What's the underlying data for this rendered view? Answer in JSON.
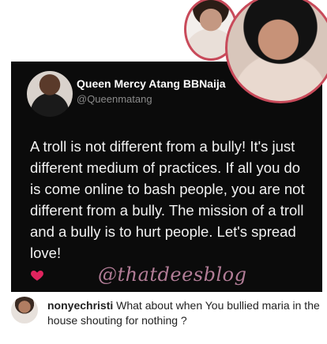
{
  "post": {
    "author_name": "Queen Mercy Atang BBNaija",
    "author_handle": "@Queenmatang",
    "text": "A troll is not different from a bully! It's just different medium of practices. If all you do is come online to bash people, you are not different from a bully. The mission of a troll and a bully is to hurt people. Let's spread love!",
    "reaction_icon": "red-heart-icon",
    "watermark": "@thatdeesblog"
  },
  "comment": {
    "username": "nonyechristi",
    "text": "What about when You bullied maria in the house shouting for nothing ?"
  },
  "colors": {
    "card_background": "#0b0b0b",
    "heart": "#e0245e",
    "photo_ring": "#c84a5a",
    "watermark": "#c489a6"
  }
}
